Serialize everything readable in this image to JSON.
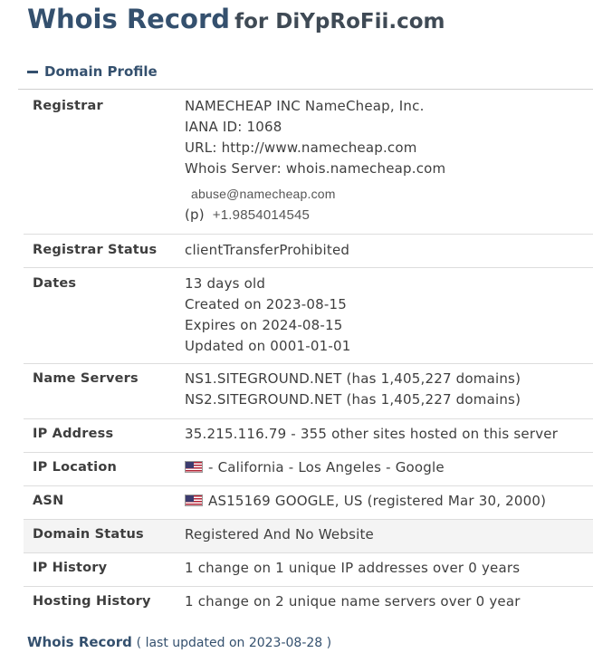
{
  "page": {
    "title_main": "Whois Record",
    "title_for": "for DiYpRoFii.com"
  },
  "section": {
    "header": "Domain Profile"
  },
  "profile": {
    "registrar": {
      "label": "Registrar",
      "name": "NAMECHEAP INC NameCheap, Inc.",
      "iana": "IANA ID: 1068",
      "url": "URL: http://www.namecheap.com",
      "whois_server": "Whois Server: whois.namecheap.com",
      "abuse_email": "abuse@namecheap.com",
      "phone_prefix": "(p)",
      "phone": "+1.9854014545"
    },
    "registrar_status": {
      "label": "Registrar Status",
      "value": "clientTransferProhibited"
    },
    "dates": {
      "label": "Dates",
      "age": "13 days old",
      "created": "Created on 2023-08-15",
      "expires": "Expires on 2024-08-15",
      "updated": "Updated on 0001-01-01"
    },
    "name_servers": {
      "label": "Name Servers",
      "ns1": "NS1.SITEGROUND.NET (has 1,405,227 domains)",
      "ns2": "NS2.SITEGROUND.NET (has 1,405,227 domains)"
    },
    "ip_address": {
      "label": "IP Address",
      "value": "35.215.116.79 - 355 other sites hosted on this server"
    },
    "ip_location": {
      "label": "IP Location",
      "flag_icon": "us-flag-icon",
      "value": "- California - Los Angeles - Google"
    },
    "asn": {
      "label": "ASN",
      "flag_icon": "us-flag-icon",
      "value": "AS15169 GOOGLE, US (registered Mar 30, 2000)"
    },
    "domain_status": {
      "label": "Domain Status",
      "value": "Registered And No Website"
    },
    "ip_history": {
      "label": "IP History",
      "value": "1 change on 1 unique IP addresses over 0 years"
    },
    "hosting_history": {
      "label": "Hosting History",
      "value": "1 change on 2 unique name servers over 0 year"
    }
  },
  "footer": {
    "title": "Whois Record",
    "subtitle": "( last updated on 2023-08-28 )"
  },
  "colors": {
    "heading": "#34506e",
    "text": "#3e3e3e",
    "shaded_row": "#f4f4f4",
    "row_border": "#dddddd"
  }
}
